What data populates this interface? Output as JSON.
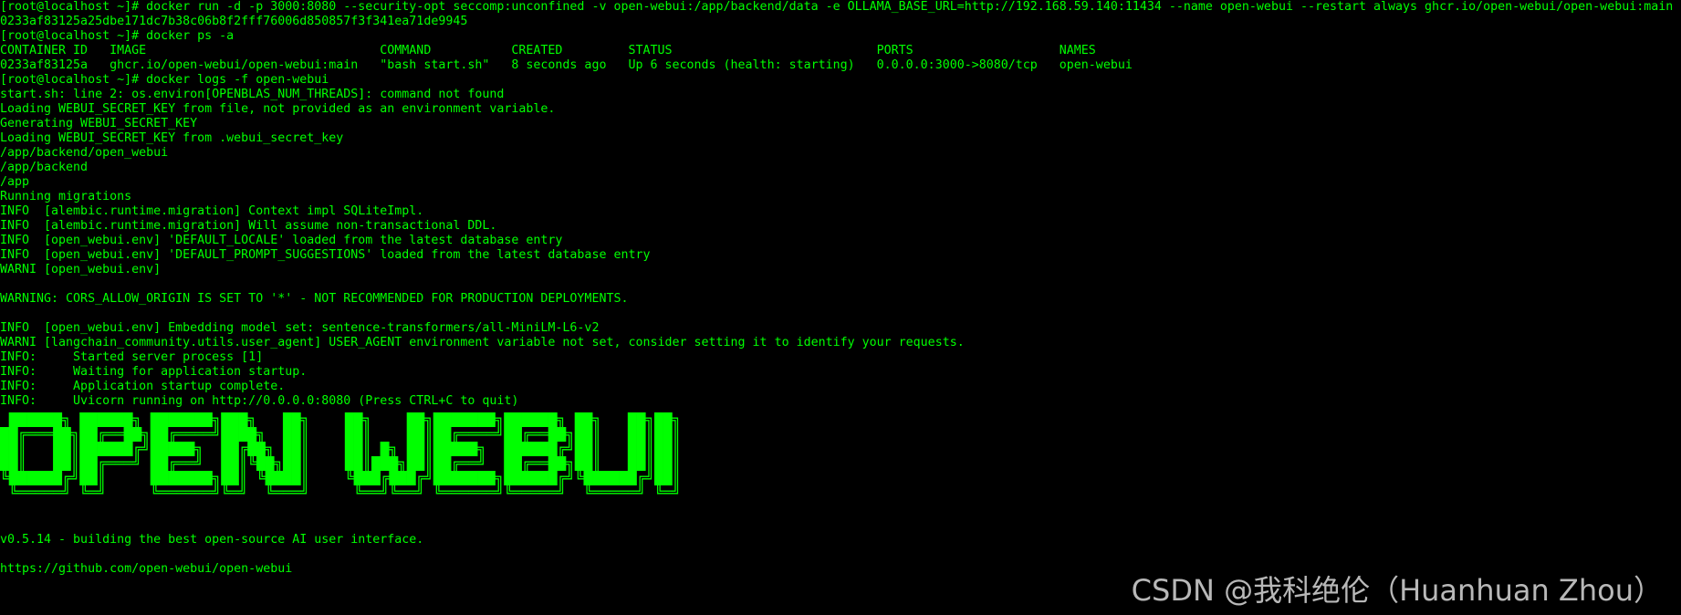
{
  "terminal": {
    "lines_top": [
      "[root@localhost ~]# docker run -d -p 3000:8080 --security-opt seccomp:unconfined -v open-webui:/app/backend/data -e OLLAMA_BASE_URL=http://192.168.59.140:11434 --name open-webui --restart always ghcr.io/open-webui/open-webui:main",
      "0233af83125a25dbe171dc7b38c06b8f2fff76006d850857f3f341ea71de9945",
      "[root@localhost ~]# docker ps -a",
      "CONTAINER ID   IMAGE                                COMMAND           CREATED         STATUS                            PORTS                    NAMES",
      "0233af83125a   ghcr.io/open-webui/open-webui:main   \"bash start.sh\"   8 seconds ago   Up 6 seconds (health: starting)   0.0.0.0:3000->8080/tcp   open-webui",
      "[root@localhost ~]# docker logs -f open-webui",
      "start.sh: line 2: os.environ[OPENBLAS_NUM_THREADS]: command not found",
      "Loading WEBUI_SECRET_KEY from file, not provided as an environment variable.",
      "Generating WEBUI_SECRET_KEY",
      "Loading WEBUI_SECRET_KEY from .webui_secret_key",
      "/app/backend/open_webui",
      "/app/backend",
      "/app",
      "Running migrations",
      "INFO  [alembic.runtime.migration] Context impl SQLiteImpl.",
      "INFO  [alembic.runtime.migration] Will assume non-transactional DDL.",
      "INFO  [open_webui.env] 'DEFAULT_LOCALE' loaded from the latest database entry",
      "INFO  [open_webui.env] 'DEFAULT_PROMPT_SUGGESTIONS' loaded from the latest database entry",
      "WARNI [open_webui.env]",
      "",
      "WARNING: CORS_ALLOW_ORIGIN IS SET TO '*' - NOT RECOMMENDED FOR PRODUCTION DEPLOYMENTS.",
      "",
      "INFO  [open_webui.env] Embedding model set: sentence-transformers/all-MiniLM-L6-v2",
      "WARNI [langchain_community.utils.user_agent] USER_AGENT environment variable not set, consider setting it to identify your requests.",
      "INFO:     Started server process [1]",
      "INFO:     Waiting for application startup.",
      "INFO:     Application startup complete.",
      "INFO:     Uvicorn running on http://0.0.0.0:8080 (Press CTRL+C to quit)"
    ],
    "banner": [
      " ██████╗ ██████╗ ███████╗███╗   ██╗    ██╗    ██╗███████╗██████╗ ██╗   ██╗██╗",
      "██╔═══██╗██╔══██╗██╔════╝████╗  ██║    ██║    ██║██╔════╝██╔══██╗██║   ██║██║",
      "██║   ██║██████╔╝█████╗  ██╔██╗ ██║    ██║ █╗ ██║█████╗  ██████╔╝██║   ██║██║",
      "██║   ██║██╔═══╝ ██╔══╝  ██║╚██╗██║    ██║███╗██║██╔══╝  ██╔══██╗██║   ██║██║",
      "╚██████╔╝██║     ███████╗██║ ╚████║    ╚███╔███╔╝███████╗██████╔╝╚██████╔╝██║",
      " ╚═════╝ ╚═╝     ╚══════╝╚═╝  ╚═══╝     ╚══╝╚══╝ ╚══════╝╚═════╝  ╚═════╝ ╚═╝"
    ],
    "lines_bottom": [
      "",
      "",
      "v0.5.14 - building the best open-source AI user interface.",
      "",
      "https://github.com/open-webui/open-webui"
    ]
  },
  "watermark": "CSDN @我科绝伦（Huanhuan Zhou）",
  "colors": {
    "background": "#000000",
    "text": "#00ff00",
    "watermark": "#d9d9d9"
  }
}
